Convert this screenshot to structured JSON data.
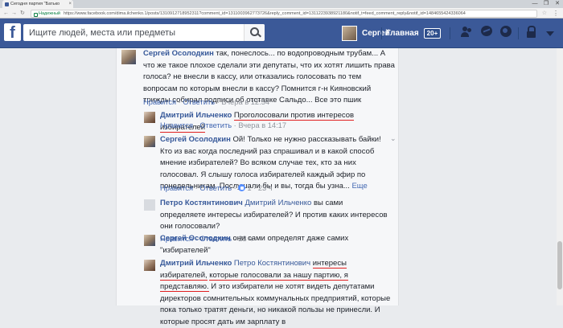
{
  "browser": {
    "tab_title": "Сегодня партия \"Батько",
    "url_secure_label": "Надежный",
    "url": "https://www.facebook.com/dima.ilchenko.1/posts/1310912718952311?comment_id=1311003962773726&reply_comment_id=1311223938921180&notif_t=feed_comment_reply&notif_id=1484655424336064",
    "controls": [
      "—",
      "❐",
      "✕"
    ]
  },
  "topbar": {
    "logo": "f",
    "search_placeholder": "Ищите людей, места или предметы",
    "user_name": "Сергей",
    "home_label": "Главная",
    "home_badge": "20+",
    "brand_color": "#3b5998"
  },
  "comments": [
    {
      "author": "Сергей Осолодкин",
      "text": "так, понеслось... по водопроводным трубам... А что же такое плохое сделали эти депутаты, что их хотят лишить права голоса? не внесли в кассу, или отказались голосовать по тем вопросам по которым внесли в кассу? Помнится г-н Кияновский трижды собирал подписи об отставке Сальдо... Все это пшик",
      "like": "Нравится",
      "reply": "Ответить",
      "time": "Вчера в 12:54"
    },
    {
      "author": "Дмитрий Ильченко",
      "text": "Проголосовали против интересов избирателей",
      "like": "Нравится",
      "reply": "Ответить",
      "time": "Вчера в 14:17"
    },
    {
      "author": "Сергей Осолодкин",
      "text": "Ой! Только не нужно рассказывать байки! Кто из вас когда последний раз спрашивал и в какой способ мнение избирателей? Во всяком случае тех, кто за них голосовал. Я слышу голоса избирателей каждый эфир по понедельникам. Послушали бы и вы, тогда бы узна...",
      "more": "Еще",
      "like": "Нравится",
      "reply": "Ответить",
      "reactions": "1",
      "time": "23 ч"
    },
    {
      "author": "Петро Костянтинович",
      "mention": "Дмитрий Ильченко",
      "text": "вы сами определяете интересы избирателей? И против каких интересов они голосовали?",
      "like": "Нравится",
      "reply": "Ответить",
      "time": "23 ч"
    },
    {
      "author": "Сергей Осолодкин",
      "text": "они сами определят даже самих \"избирателей\""
    },
    {
      "author": "Дмитрий Ильченко",
      "mention": "Петро Костянтинович",
      "text_a": "интересы избирателей,",
      "text_b": "которые голосовали за нашу партию, я представляю.",
      "text_c": "И это избиратели не хотят видеть депутатами директоров сомнительных коммунальных предприятий, которые пока только тратят деньги, но никакой пользы не принесли. И которые просят дать им зарплату в"
    }
  ],
  "dot_sep": "·"
}
